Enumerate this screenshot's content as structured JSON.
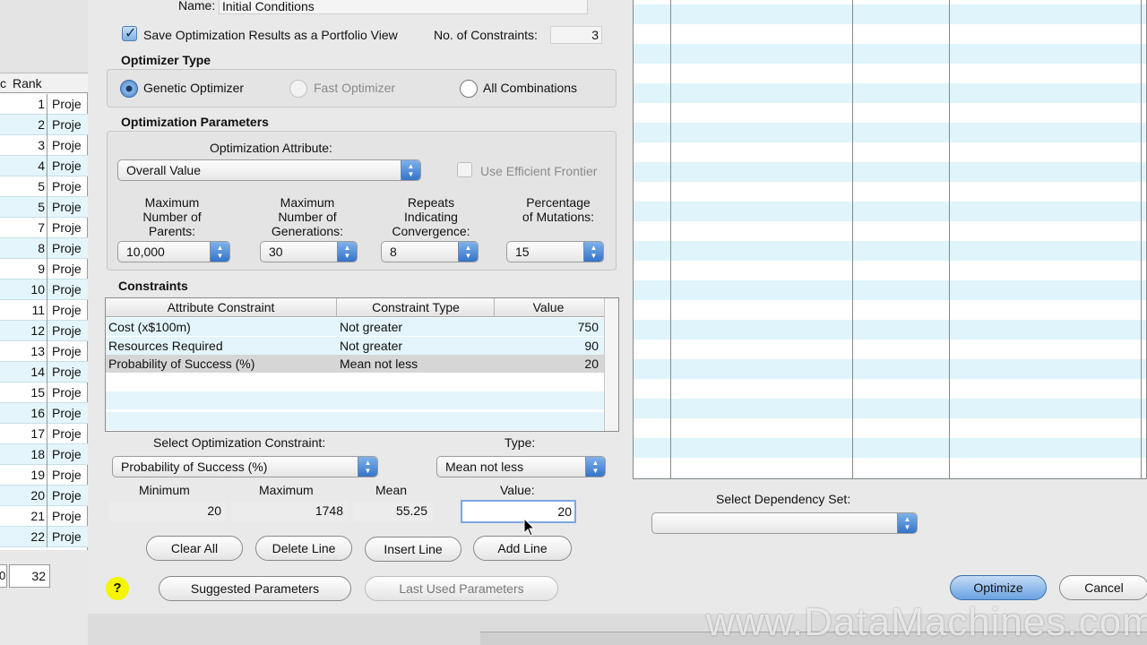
{
  "background_sheet": {
    "rank_header": "Rank",
    "rows": [
      {
        "rank": "1",
        "name": "Proje"
      },
      {
        "rank": "2",
        "name": "Proje"
      },
      {
        "rank": "3",
        "name": "Proje"
      },
      {
        "rank": "4",
        "name": "Proje"
      },
      {
        "rank": "5",
        "name": "Proje"
      },
      {
        "rank": "5",
        "name": "Proje"
      },
      {
        "rank": "7",
        "name": "Proje"
      },
      {
        "rank": "8",
        "name": "Proje"
      },
      {
        "rank": "9",
        "name": "Proje"
      },
      {
        "rank": "10",
        "name": "Proje"
      },
      {
        "rank": "11",
        "name": "Proje"
      },
      {
        "rank": "12",
        "name": "Proje"
      },
      {
        "rank": "13",
        "name": "Proje"
      },
      {
        "rank": "14",
        "name": "Proje"
      },
      {
        "rank": "15",
        "name": "Proje"
      },
      {
        "rank": "16",
        "name": "Proje"
      },
      {
        "rank": "17",
        "name": "Proje"
      },
      {
        "rank": "18",
        "name": "Proje"
      },
      {
        "rank": "19",
        "name": "Proje"
      },
      {
        "rank": "20",
        "name": "Proje"
      },
      {
        "rank": "21",
        "name": "Proje"
      },
      {
        "rank": "22",
        "name": "Proje"
      }
    ],
    "footer_left": "0",
    "footer_value": "32"
  },
  "dialog": {
    "name_label": "Name:",
    "name_value": "Initial Conditions",
    "save_checkbox_label": "Save Optimization Results as a Portfolio View",
    "constraints_count_label": "No. of Constraints:",
    "constraints_count_value": "3",
    "optimizer_type": {
      "title": "Optimizer Type",
      "options": [
        "Genetic Optimizer",
        "Fast Optimizer",
        "All Combinations"
      ],
      "selected": "Genetic Optimizer"
    },
    "parameters": {
      "title": "Optimization Parameters",
      "attribute_label": "Optimization Attribute:",
      "attribute_value": "Overall Value",
      "efficient_frontier_label": "Use Efficient Frontier",
      "max_parents_label": [
        "Maximum",
        "Number of",
        "Parents:"
      ],
      "max_parents_value": "10,000",
      "max_generations_label": [
        "Maximum",
        "Number of",
        "Generations:"
      ],
      "max_generations_value": "30",
      "repeats_label": [
        "Repeats",
        "Indicating",
        "Convergence:"
      ],
      "repeats_value": "8",
      "mutations_label": [
        "Percentage",
        "of Mutations:"
      ],
      "mutations_value": "15"
    },
    "constraints": {
      "title": "Constraints",
      "columns": [
        "Attribute Constraint",
        "Constraint Type",
        "Value"
      ],
      "rows": [
        {
          "attribute": "Cost (x$100m)",
          "type": "Not greater",
          "value": "750"
        },
        {
          "attribute": "Resources Required",
          "type": "Not greater",
          "value": "90"
        },
        {
          "attribute": "Probability of Success (%)",
          "type": "Mean not less",
          "value": "20"
        }
      ]
    },
    "select_constraint_label": "Select Optimization Constraint:",
    "select_constraint_value": "Probability of Success (%)",
    "type_label": "Type:",
    "type_value": "Mean not less",
    "minimum_label": "Minimum",
    "minimum_value": "20",
    "maximum_label": "Maximum",
    "maximum_value": "1748",
    "mean_label": "Mean",
    "mean_value": "55.25",
    "value_label": "Value:",
    "value_input": "20",
    "buttons": {
      "clear_all": "Clear All",
      "delete_line": "Delete Line",
      "insert_line": "Insert Line",
      "add_line": "Add Line",
      "suggested": "Suggested Parameters",
      "last_used": "Last Used Parameters",
      "optimize": "Optimize",
      "cancel": "Cancel",
      "help": "?"
    },
    "dependency_label": "Select Dependency Set:",
    "dependency_value": ""
  },
  "watermark": "www.DataMachines.com"
}
